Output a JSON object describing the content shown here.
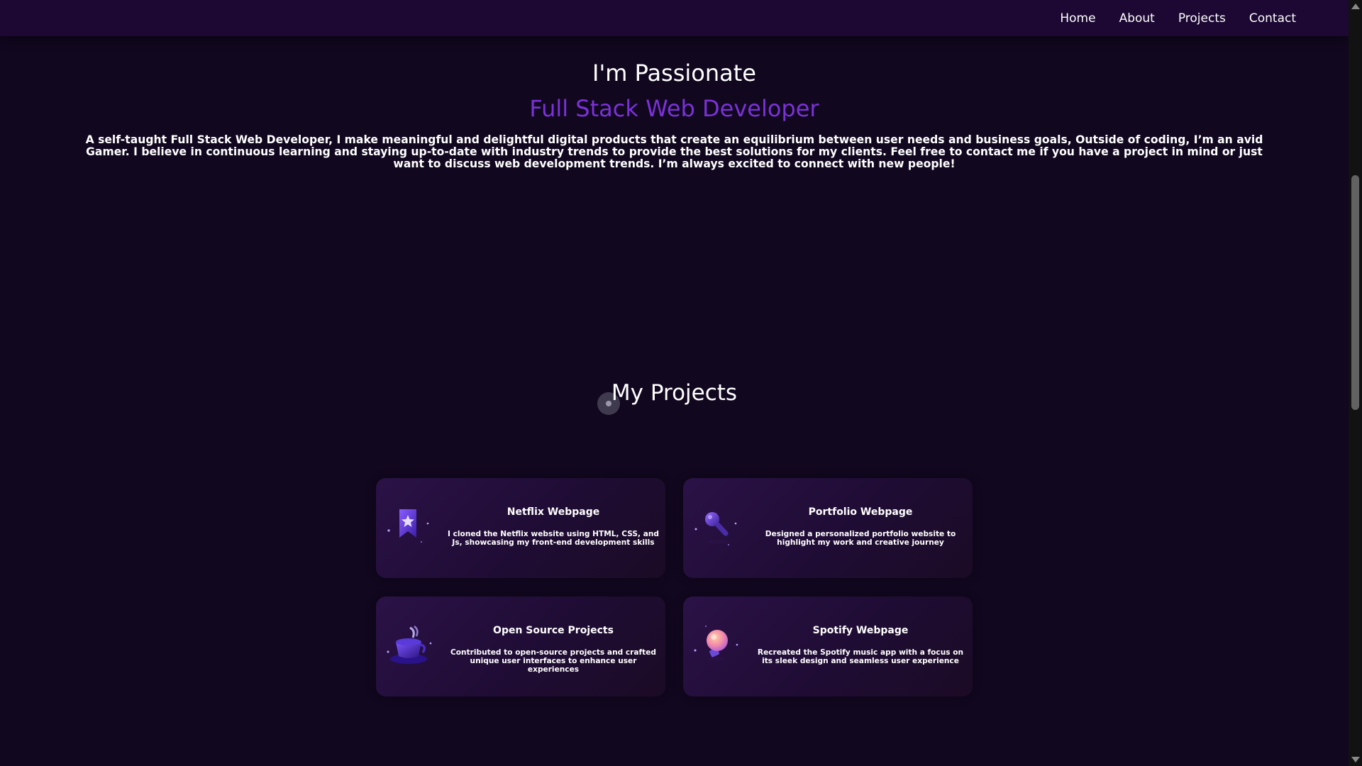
{
  "nav": {
    "links": [
      "Home",
      "About",
      "Projects",
      "Contact"
    ]
  },
  "hero": {
    "title": "I'm Passionate",
    "subtitle": "Full Stack Web Developer",
    "bio": "A self-taught Full Stack Web Developer, I make meaningful and delightful digital products that create an equilibrium between user needs and business goals, Outside of coding, I’m an avid Gamer. I believe in continuous learning and staying up-to-date with industry trends to provide the best solutions for my clients. Feel free to contact me if you have a project in mind or just want to discuss web development trends. I’m always excited to connect with new people!"
  },
  "projects": {
    "title": "My Projects",
    "cards": [
      {
        "title": "Netflix Webpage",
        "description": "I cloned the Netflix website using HTML, CSS, and Js, showcasing my front-end development skills",
        "icon": "bookmark-star-icon"
      },
      {
        "title": "Portfolio Webpage",
        "description": "Designed a personalized portfolio website to highlight my work and creative journey",
        "icon": "microphone-icon"
      },
      {
        "title": "Open Source Projects",
        "description": "Contributed to open-source projects and crafted unique user interfaces to enhance user experiences",
        "icon": "coffee-cup-icon"
      },
      {
        "title": "Spotify Webpage",
        "description": "Recreated the Spotify music app with a focus on its sleek design and seamless user experience",
        "icon": "lightbulb-icon"
      }
    ]
  },
  "colors": {
    "background": "#11071f",
    "navbar": "#1c0833",
    "accent": "#7b31d9"
  }
}
